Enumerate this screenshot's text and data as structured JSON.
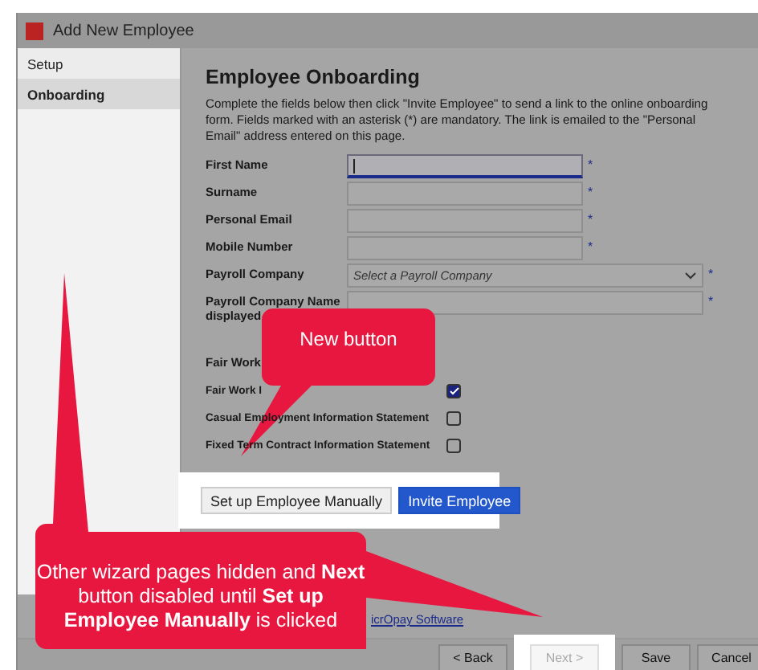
{
  "window": {
    "title": "Add New Employee"
  },
  "sidebar": {
    "items": [
      {
        "label": "Setup",
        "selected": false
      },
      {
        "label": "Onboarding",
        "selected": true
      }
    ]
  },
  "page": {
    "heading": "Employee Onboarding",
    "intro": "Complete the fields below then click \"Invite Employee\" to send a link to the online onboarding form. Fields marked with an asterisk (*) are mandatory. The link is emailed to the \"Personal Email\" address entered on this page.",
    "fields": [
      {
        "label": [
          "First Name"
        ],
        "kind": "text",
        "focused": true,
        "marker": "*"
      },
      {
        "label": [
          "Surname"
        ],
        "kind": "text",
        "marker": "*"
      },
      {
        "label": [
          "Personal Email"
        ],
        "kind": "text",
        "marker": "*"
      },
      {
        "label": [
          "Mobile Number"
        ],
        "kind": "text",
        "marker": "*"
      },
      {
        "label": [
          "Payroll Company"
        ],
        "kind": "select",
        "placeholder": "Select a Payroll Company",
        "marker": "*"
      },
      {
        "label": [
          "Payroll Company Name",
          "displayed"
        ],
        "kind": "wide-text",
        "marker": "*"
      }
    ],
    "section_heading": "Fair Work",
    "statements": [
      {
        "label": "Fair Work I",
        "checked": true
      },
      {
        "label": "Casual Employment Information Statement",
        "checked": false
      },
      {
        "label": "Fixed Term Contract Information Statement",
        "checked": false
      }
    ],
    "actions": [
      {
        "label": "Set up Employee Manually",
        "kind": "secondary"
      },
      {
        "label": "Invite Employee",
        "kind": "primary"
      }
    ],
    "link": "icrOpay Software"
  },
  "footer": {
    "buttons": [
      {
        "label": "< Back",
        "disabled": false,
        "highlighted": false
      },
      {
        "label": "Next >",
        "disabled": true,
        "highlighted": true
      },
      {
        "label": "Save",
        "disabled": false,
        "highlighted": false
      },
      {
        "label": "Cancel",
        "disabled": false,
        "highlighted": false
      }
    ]
  },
  "callouts": [
    {
      "text": "New button"
    },
    {
      "text": "Other wizard pages hidden and **Next** button disabled until **Set up Employee Manually** is clicked"
    }
  ]
}
